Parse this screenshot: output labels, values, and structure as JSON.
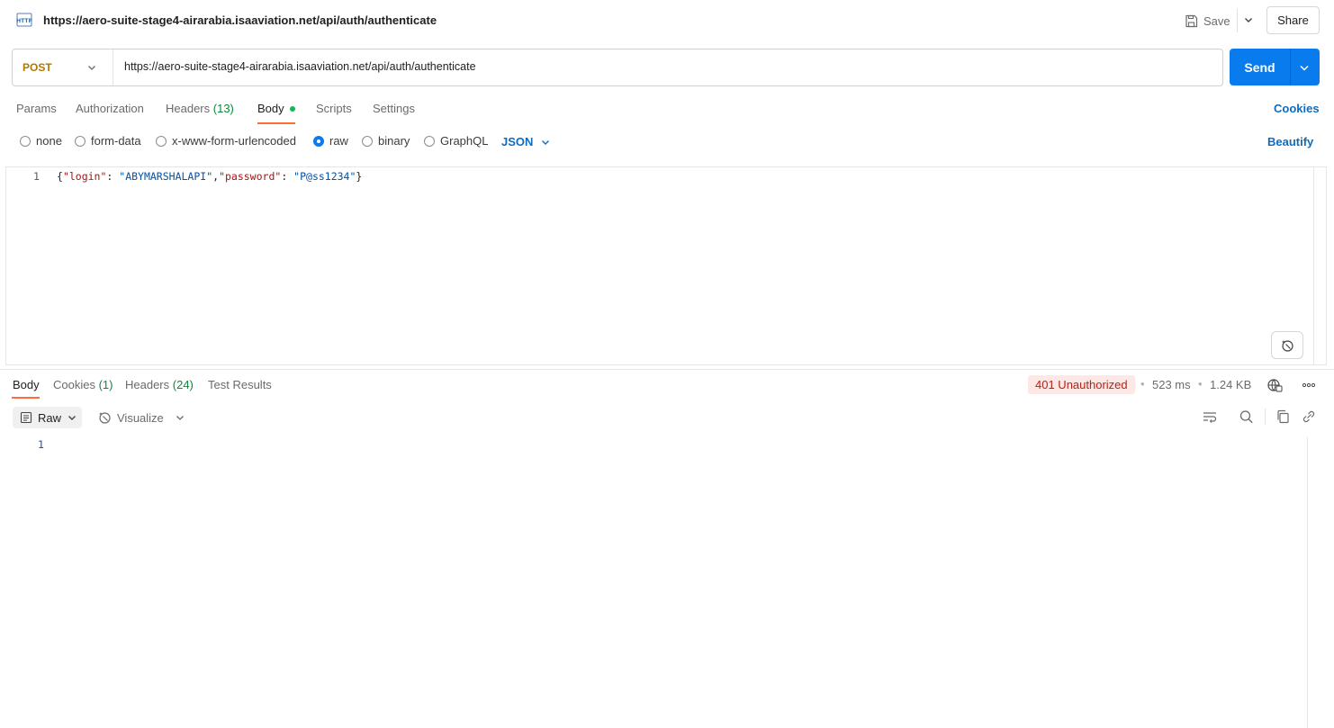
{
  "header": {
    "title": "https://aero-suite-stage4-airarabia.isaaviation.net/api/auth/authenticate",
    "save_label": "Save",
    "share_label": "Share"
  },
  "request": {
    "method": "POST",
    "url": "https://aero-suite-stage4-airarabia.isaaviation.net/api/auth/authenticate",
    "send_label": "Send"
  },
  "request_tabs": {
    "params": "Params",
    "authorization": "Authorization",
    "headers": "Headers",
    "headers_count": "(13)",
    "body": "Body",
    "scripts": "Scripts",
    "settings": "Settings",
    "cookies": "Cookies"
  },
  "body_types": {
    "none": "none",
    "form_data": "form-data",
    "urlencoded": "x-www-form-urlencoded",
    "raw": "raw",
    "binary": "binary",
    "graphql": "GraphQL",
    "selected": "raw",
    "format": "JSON",
    "beautify": "Beautify"
  },
  "editor": {
    "line_number": "1",
    "code": {
      "open": "{",
      "key1": "\"login\"",
      "sep1": ": ",
      "val1": "\"ABYMARSHALAPI\"",
      "comma": ",",
      "key2": "\"password\"",
      "sep2": ": ",
      "val2": "\"P@ss1234\"",
      "close": "}"
    }
  },
  "response_tabs": {
    "body": "Body",
    "cookies": "Cookies",
    "cookies_count": "(1)",
    "headers": "Headers",
    "headers_count": "(24)",
    "test_results": "Test Results"
  },
  "response_meta": {
    "status": "401 Unauthorized",
    "time": "523 ms",
    "size": "1.24 KB",
    "bullet": "•"
  },
  "response_toolbar": {
    "raw": "Raw",
    "visualize": "Visualize"
  },
  "response_body": {
    "line_number": "1"
  },
  "colors": {
    "accent": "#097bed",
    "tab_underline": "#ff6c37",
    "method": "#ad7a03",
    "error": "#b42318",
    "success_dot": "#0cbb52"
  }
}
